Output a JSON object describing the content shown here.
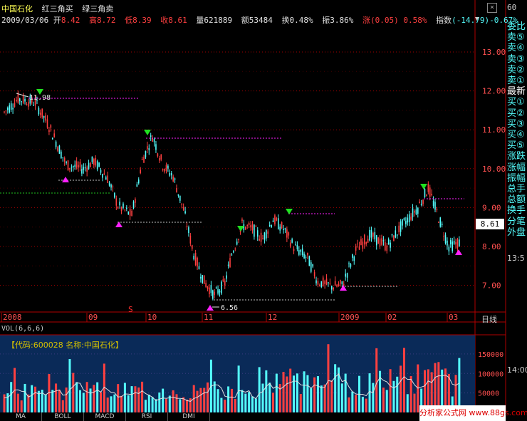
{
  "header": {
    "ticker": "中国石化",
    "legend_red": "红三角买",
    "legend_green": "绿三角卖",
    "date": "2009/03/06",
    "open_label": "开",
    "open": "8.42",
    "high_label": "高",
    "high": "8.72",
    "low_label": "低",
    "low": "8.39",
    "close_label": "收",
    "close": "8.61",
    "volume_label": "量",
    "volume": "621889",
    "amount_label": "额",
    "amount": "53484",
    "turnover_label": "换",
    "turnover": "0.48%",
    "amplitude_label": "振",
    "amplitude": "3.86%",
    "change_label": "涨",
    "change": "(0.05)",
    "change_pct": "0.58%",
    "index_label": "指数",
    "index_change": "(-14.79)",
    "index_pct": "-0.67%"
  },
  "price_axis": {
    "ticks": [
      "13.00",
      "12.00",
      "11.00",
      "10.00",
      "9.00",
      "8.00",
      "7.00"
    ],
    "current_price_tag": "8.61"
  },
  "time_axis": {
    "labels": [
      "2008",
      "09",
      "10",
      "11",
      "12",
      "2009",
      "02",
      "03"
    ],
    "period_button": "日线"
  },
  "annotations": {
    "high_label": "11.98",
    "low_label": "6.56",
    "s_marker": "S"
  },
  "volume_panel": {
    "title": "VOL(6,6,6)",
    "info": "【代码:600028 名称:中国石化】",
    "ticks": [
      "150000",
      "100000",
      "50000"
    ]
  },
  "side_panel": {
    "top_text": "60",
    "items": [
      "委比",
      "卖⑤",
      "卖④",
      "卖③",
      "卖②",
      "卖①",
      "最新",
      "买①",
      "买②",
      "买③",
      "买④",
      "买⑤",
      "涨跌",
      "涨幅",
      "振幅",
      "总手",
      "总额",
      "换手",
      "分笔",
      "外盘"
    ],
    "side_numbers": [
      "13:5",
      "14:00"
    ]
  },
  "footer_tabs": [
    "MA",
    "BOLL",
    "MACD",
    "RSI",
    "DMI"
  ],
  "watermark": "分析家公式网 www.88gs.com",
  "close_button": "×",
  "colors": {
    "up": "#ff4040",
    "down": "#54fcfc",
    "grid": "#a00000",
    "buy_marker": "#ff20ff",
    "sell_marker": "#20e020",
    "support": "#ff20ff",
    "volume_bg": "#0a2a58"
  }
}
